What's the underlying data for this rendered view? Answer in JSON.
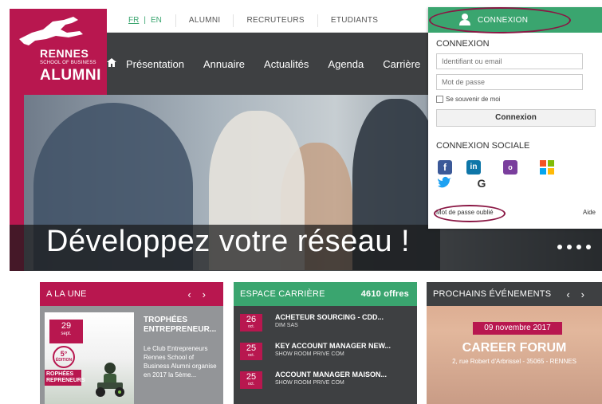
{
  "languages": {
    "fr": "FR",
    "separator": "|",
    "en": "EN"
  },
  "top_links": [
    "ALUMNI",
    "RECRUTEURS",
    "ETUDIANTS"
  ],
  "logo": {
    "line1": "RENNES",
    "line2": "SCHOOL OF BUSINESS",
    "line3": "ALUMNI"
  },
  "nav": {
    "items": [
      "Présentation",
      "Annuaire",
      "Actualités",
      "Agenda",
      "Carrière"
    ]
  },
  "hero": {
    "tagline": "Développez votre réseau !"
  },
  "login": {
    "header": "CONNEXION",
    "title": "CONNEXION",
    "id_placeholder": "Identifiant ou email",
    "password_placeholder": "Mot de passe",
    "remember": "Se souvenir de moi",
    "submit": "Connexion",
    "social_title": "CONNEXION SOCIALE",
    "forgot": "Mot de passe oublié",
    "help": "Aide"
  },
  "cards": {
    "une": {
      "title": "A LA UNE",
      "prev": "‹",
      "next": "›",
      "date_day": "29",
      "date_month": "sept.",
      "edition_num": "5°",
      "edition_label": "ÉDITION",
      "trophy_label": "ROPHÉES\nREPRENEURS",
      "article_title": "TROPHÉES ENTREPRENEUR...",
      "article_text": "Le Club Entrepreneurs Rennes School of Business Alumni organise en 2017 la 5ème..."
    },
    "carriere": {
      "title": "ESPACE CARRIÈRE",
      "offers": "4610 offres",
      "jobs": [
        {
          "day": "26",
          "month": "oct.",
          "title": "ACHETEUR SOURCING - CDD...",
          "company": "DIM SAS"
        },
        {
          "day": "25",
          "month": "oct.",
          "title": "KEY ACCOUNT MANAGER NEW...",
          "company": "SHOW ROOM PRIVE COM"
        },
        {
          "day": "25",
          "month": "oct.",
          "title": "ACCOUNT MANAGER MAISON...",
          "company": "SHOW ROOM PRIVE COM"
        }
      ]
    },
    "events": {
      "title": "PROCHAINS ÉVÉNEMENTS",
      "prev": "‹",
      "next": "›",
      "date": "09 novembre 2017",
      "name": "CAREER FORUM",
      "address": "2, rue Robert d'Arbrissel - 35065 - RENNES"
    }
  },
  "colors": {
    "brand": "#b8174f",
    "green": "#3aa56f",
    "dark": "#3e4042",
    "annotation": "#8a1744"
  }
}
